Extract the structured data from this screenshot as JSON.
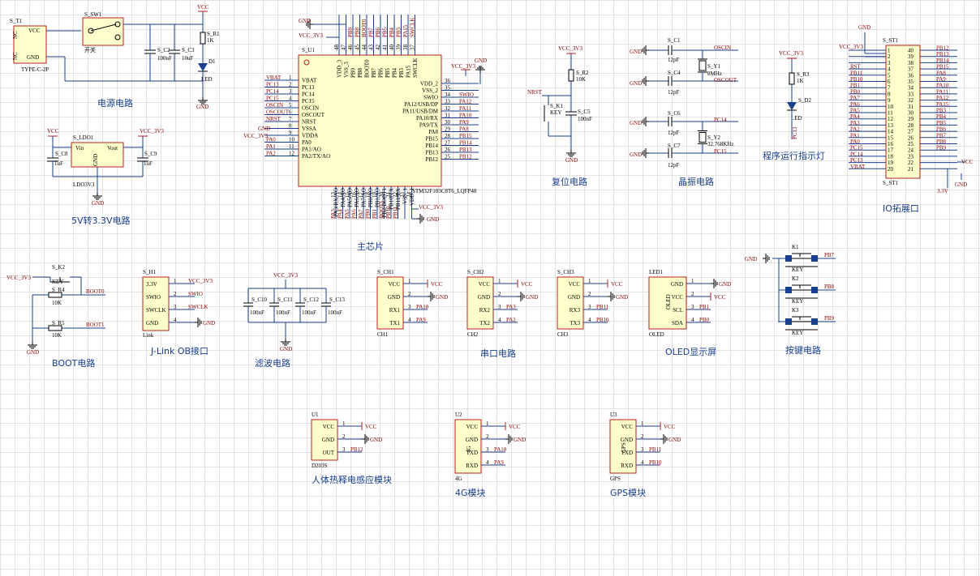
{
  "sections": {
    "power": "电源电路",
    "ldo": "5V转3.3V电路",
    "main": "主芯片",
    "reset": "复位电路",
    "crystal": "晶振电路",
    "led": "程序运行指示灯",
    "io": "IO拓展口",
    "boot": "BOOT电路",
    "jlink": "J-Link OB接口",
    "filter": "滤波电路",
    "uart": "串口电路",
    "oled": "OLED显示屏",
    "keys": "按键电路",
    "pir": "人体热释电感应模块",
    "m4g": "4G模块",
    "gps": "GPS模块"
  },
  "power": {
    "t1_ref": "S_T1",
    "t1_type": "TYPE-C-2P",
    "t1_pins": [
      "VCC",
      "GND",
      "NC",
      "NC"
    ],
    "sw_ref": "S_SW1",
    "sw_label": "开关",
    "c2": "S_C2",
    "c2v": "100nF",
    "c3": "S_C3",
    "c3v": "10uF",
    "r1": "S_R1",
    "r1v": "1K",
    "d1": "D1",
    "d1v": "LED",
    "vcc": "VCC",
    "gnd": "GND"
  },
  "ldo": {
    "ref": "S_LDO1",
    "part": "LDO3V3",
    "vin": "Vin",
    "vout": "Vout",
    "gndpin": "GND",
    "c8": "S_C8",
    "c8v": "1uF",
    "c9": "S_C9",
    "c9v": "1uF",
    "vcc": "VCC",
    "v33": "VCC_3V3",
    "gnd": "GND"
  },
  "mcu": {
    "ref": "S_U1",
    "part": "STM32F103C8T6_LQFP48",
    "left": [
      {
        "n": "1",
        "name": "VBAT",
        "net": "VBAT"
      },
      {
        "n": "2",
        "name": "PC13",
        "net": "PC13"
      },
      {
        "n": "3",
        "name": "PC14",
        "net": "PC14"
      },
      {
        "n": "4",
        "name": "PC15",
        "net": "PC15"
      },
      {
        "n": "5",
        "name": "OSCIN",
        "net": "OSCIN"
      },
      {
        "n": "6",
        "name": "OSCOUT",
        "net": "OSCOUT"
      },
      {
        "n": "7",
        "name": "NRST",
        "net": "NRST"
      },
      {
        "n": "8",
        "name": "VSSA",
        "net": "GND"
      },
      {
        "n": "9",
        "name": "VDDA",
        "net": "VCC_3V3"
      },
      {
        "n": "10",
        "name": "PA0",
        "net": "PA0"
      },
      {
        "n": "11",
        "name": "PA1/AO",
        "net": "PA1"
      },
      {
        "n": "12",
        "name": "PA2/TX/AO",
        "net": "PA2"
      }
    ],
    "right": [
      {
        "n": "36",
        "name": "VDD_2",
        "net": "VCC_3V3"
      },
      {
        "n": "35",
        "name": "VSS_2",
        "net": "GND"
      },
      {
        "n": "34",
        "name": "SWIO",
        "net": "SWIO"
      },
      {
        "n": "33",
        "name": "PA12/USB/DP",
        "net": "PA12"
      },
      {
        "n": "32",
        "name": "PA11/USB/DM",
        "net": "PA11"
      },
      {
        "n": "31",
        "name": "PA10/RX",
        "net": "PA10"
      },
      {
        "n": "30",
        "name": "PA9/TX",
        "net": "PA9"
      },
      {
        "n": "29",
        "name": "PA8",
        "net": "PA8"
      },
      {
        "n": "28",
        "name": "PB15",
        "net": "PB15"
      },
      {
        "n": "27",
        "name": "PB14",
        "net": "PB14"
      },
      {
        "n": "26",
        "name": "PB13",
        "net": "PB13"
      },
      {
        "n": "25",
        "name": "PB12",
        "net": "PB12"
      }
    ],
    "top": [
      {
        "n": "48",
        "name": "VDD_3",
        "net": "VCC_3V3"
      },
      {
        "n": "47",
        "name": "VSS_3",
        "net": "GND"
      },
      {
        "n": "46",
        "name": "PB9",
        "net": "PB9"
      },
      {
        "n": "45",
        "name": "PB8",
        "net": "PB8"
      },
      {
        "n": "44",
        "name": "BOOT0",
        "net": "BOOT0"
      },
      {
        "n": "43",
        "name": "PB7",
        "net": "PB7"
      },
      {
        "n": "42",
        "name": "PB6",
        "net": "PB6"
      },
      {
        "n": "41",
        "name": "PB5",
        "net": "PB5"
      },
      {
        "n": "40",
        "name": "PB4",
        "net": "PB4"
      },
      {
        "n": "39",
        "name": "PB3",
        "net": "PB3"
      },
      {
        "n": "38",
        "name": "PA15",
        "net": "PA15"
      },
      {
        "n": "37",
        "name": "SWCLK",
        "net": "SWCLK"
      }
    ],
    "bottom": [
      {
        "n": "13",
        "name": "PA3/RX/AO",
        "net": "PA3"
      },
      {
        "n": "14",
        "name": "PA4/AO",
        "net": "PA4"
      },
      {
        "n": "15",
        "name": "PA5/AO",
        "net": "PA5"
      },
      {
        "n": "16",
        "name": "PA6/AO",
        "net": "PA6"
      },
      {
        "n": "17",
        "name": "PA7/AO",
        "net": "PA7"
      },
      {
        "n": "18",
        "name": "PB0/AO",
        "net": "PB0"
      },
      {
        "n": "19",
        "name": "PB1/AO",
        "net": "PB1"
      },
      {
        "n": "20",
        "name": "PB2/BOOT1",
        "net": "BOOT1"
      },
      {
        "n": "21",
        "name": "PB10/TX",
        "net": "PB10"
      },
      {
        "n": "22",
        "name": "PB11/RX",
        "net": "PB11"
      },
      {
        "n": "23",
        "name": "VSS_1",
        "net": "GND"
      },
      {
        "n": "24",
        "name": "VDD_1",
        "net": "VCC_3V3"
      }
    ],
    "v33": "VCC_3V3",
    "gnd": "GND"
  },
  "reset": {
    "v33": "VCC_3V3",
    "r2": "S_R2",
    "r2v": "10K",
    "k": "S_K1",
    "kv": "KEY",
    "c5": "S_C5",
    "c5v": "100nF",
    "net": "NRST",
    "gnd": "GND"
  },
  "crystal": {
    "c1": "S_C1",
    "c4": "S_C4",
    "c6": "S_C6",
    "c7": "S_C7",
    "cv": "12pF",
    "y1": "S_Y1",
    "y1v": "8MHz",
    "y2": "S_Y2",
    "y2v": "32.768KHz",
    "n1": "OSCIN",
    "n2": "OSCOUT",
    "n3": "PC14",
    "n4": "PC15",
    "gnd": "GND"
  },
  "led": {
    "v33": "VCC_3V3",
    "r3": "S_R3",
    "r3v": "1K",
    "d2": "S_D2",
    "d2v": "LED",
    "net": "PC13"
  },
  "io": {
    "ref": "S_ST1",
    "v33": "VCC_3V3",
    "gnd": "GND",
    "vcc": "VCC",
    "v5": "3.3V",
    "left": [
      "VCC_3V3",
      "GND",
      "",
      "RST",
      "PB11",
      "PB10",
      "PB1",
      "PB0",
      "PA7",
      "PA6",
      "PA5",
      "PA4",
      "PA3",
      "PA2",
      "PA1",
      "PA0",
      "PC15",
      "PC14",
      "PC13",
      "VBAT"
    ],
    "right": [
      "PB12",
      "PB13",
      "PB14",
      "PB15",
      "PA8",
      "PA9",
      "PA10",
      "PA11",
      "PA12",
      "PA15",
      "PB3",
      "PB4",
      "PB5",
      "PB6",
      "PB7",
      "PB8",
      "PB9",
      "",
      "",
      ""
    ]
  },
  "boot": {
    "v33": "VCC_3V3",
    "k2": "S_K2",
    "k2v": "KEY",
    "r4": "S_R4",
    "r4v": "10K",
    "r5": "S_R5",
    "r5v": "10K",
    "n0": "BOOT0",
    "n1": "BOOT1",
    "gnd": "GND"
  },
  "jlink": {
    "ref": "S_H1",
    "part": "Link",
    "pins": [
      {
        "n": "1",
        "name": "3.3V",
        "net": "VCC_3V3"
      },
      {
        "n": "2",
        "name": "SWIO",
        "net": "SWIO"
      },
      {
        "n": "3",
        "name": "SWCLK",
        "net": "SWCLK"
      },
      {
        "n": "4",
        "name": "GND",
        "net": "GND"
      }
    ]
  },
  "filter": {
    "v33": "VCC_3V3",
    "gnd": "GND",
    "caps": [
      {
        "r": "S_C10",
        "v": "100nF"
      },
      {
        "r": "S_C11",
        "v": "100nF"
      },
      {
        "r": "S_C12",
        "v": "100nF"
      },
      {
        "r": "S_C13",
        "v": "100nF"
      }
    ]
  },
  "uarts": [
    {
      "ref": "S_CH1",
      "part": "CH1",
      "pins": [
        "VCC",
        "GND",
        "RX1",
        "TX1"
      ],
      "nets": [
        "VCC",
        "GND",
        "PA10",
        "PA9"
      ]
    },
    {
      "ref": "S_CH2",
      "part": "CH2",
      "pins": [
        "VCC",
        "GND",
        "RX2",
        "TX2"
      ],
      "nets": [
        "VCC",
        "GND",
        "PA3",
        "PA2"
      ]
    },
    {
      "ref": "S_CH3",
      "part": "CH3",
      "pins": [
        "VCC",
        "GND",
        "RX3",
        "TX3"
      ],
      "nets": [
        "VCC",
        "GND",
        "PB11",
        "PB10"
      ]
    }
  ],
  "oled": {
    "ref": "LED1",
    "part": "OLED",
    "body": "OLED",
    "pins": [
      "GND",
      "VCC",
      "SCL",
      "SDA"
    ],
    "nets": [
      "GND",
      "VCC",
      "PB1",
      "PB0"
    ]
  },
  "keys": {
    "gnd": "GND",
    "items": [
      {
        "r": "K1",
        "v": "KEY",
        "net": "PB7"
      },
      {
        "r": "K2",
        "v": "KEY",
        "net": "PB8"
      },
      {
        "r": "K3",
        "v": "KEY",
        "net": "PB9"
      }
    ]
  },
  "modules": [
    {
      "ref": "U1",
      "part": "D203S",
      "body": "",
      "pins": [
        "VCC",
        "GND",
        "OUT"
      ],
      "nets": [
        "VCC",
        "GND",
        "PB12"
      ]
    },
    {
      "ref": "U2",
      "part": "4G",
      "body": "4G",
      "pins": [
        "VCC",
        "GND",
        "TXD",
        "RXD"
      ],
      "nets": [
        "VCC",
        "GND",
        "PA10",
        "PA9"
      ]
    },
    {
      "ref": "U3",
      "part": "GPS",
      "body": "GPS",
      "pins": [
        "VCC",
        "GND",
        "TXD",
        "RXD"
      ],
      "nets": [
        "VCC",
        "GND",
        "PB11",
        "PB10"
      ]
    }
  ]
}
